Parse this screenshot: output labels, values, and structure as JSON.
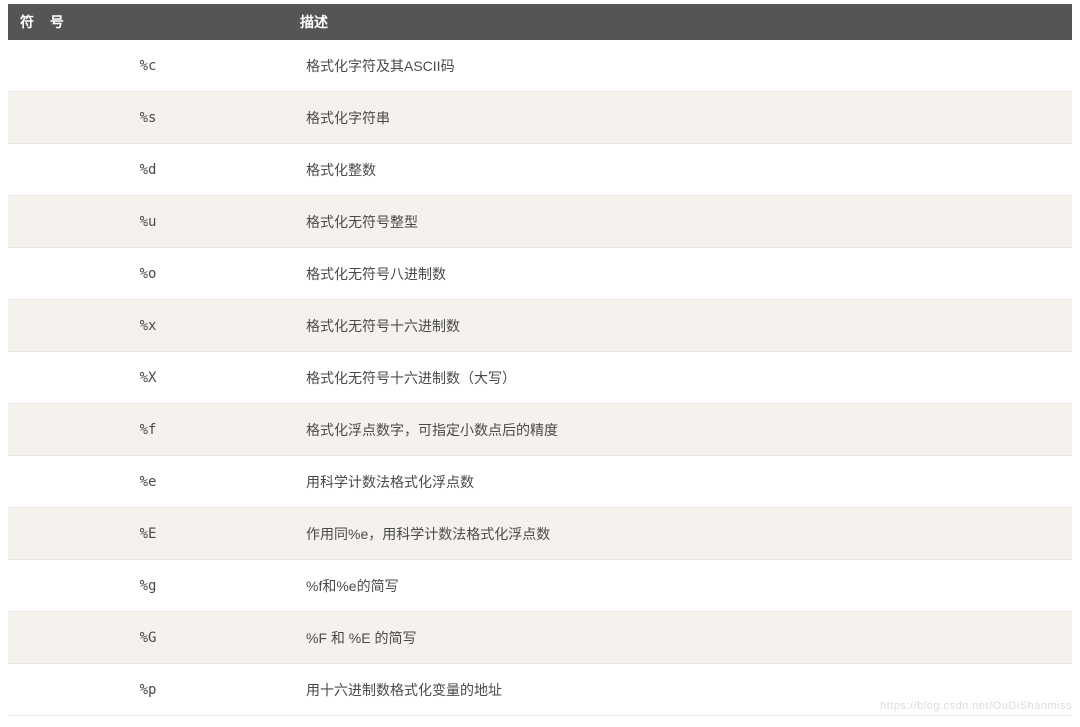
{
  "table": {
    "headers": {
      "symbol": "符 号",
      "description": "描述"
    },
    "rows": [
      {
        "symbol": "%c",
        "description": "格式化字符及其ASCII码"
      },
      {
        "symbol": "%s",
        "description": "格式化字符串"
      },
      {
        "symbol": "%d",
        "description": "格式化整数"
      },
      {
        "symbol": "%u",
        "description": "格式化无符号整型"
      },
      {
        "symbol": "%o",
        "description": "格式化无符号八进制数"
      },
      {
        "symbol": "%x",
        "description": "格式化无符号十六进制数"
      },
      {
        "symbol": "%X",
        "description": "格式化无符号十六进制数（大写）"
      },
      {
        "symbol": "%f",
        "description": "格式化浮点数字，可指定小数点后的精度"
      },
      {
        "symbol": "%e",
        "description": "用科学计数法格式化浮点数"
      },
      {
        "symbol": "%E",
        "description": "作用同%e，用科学计数法格式化浮点数"
      },
      {
        "symbol": "%g",
        "description": "%f和%e的简写"
      },
      {
        "symbol": "%G",
        "description": "%F 和 %E 的简写"
      },
      {
        "symbol": "%p",
        "description": "用十六进制数格式化变量的地址"
      }
    ]
  },
  "watermark": "https://blog.csdn.net/OuDiShanmiss"
}
